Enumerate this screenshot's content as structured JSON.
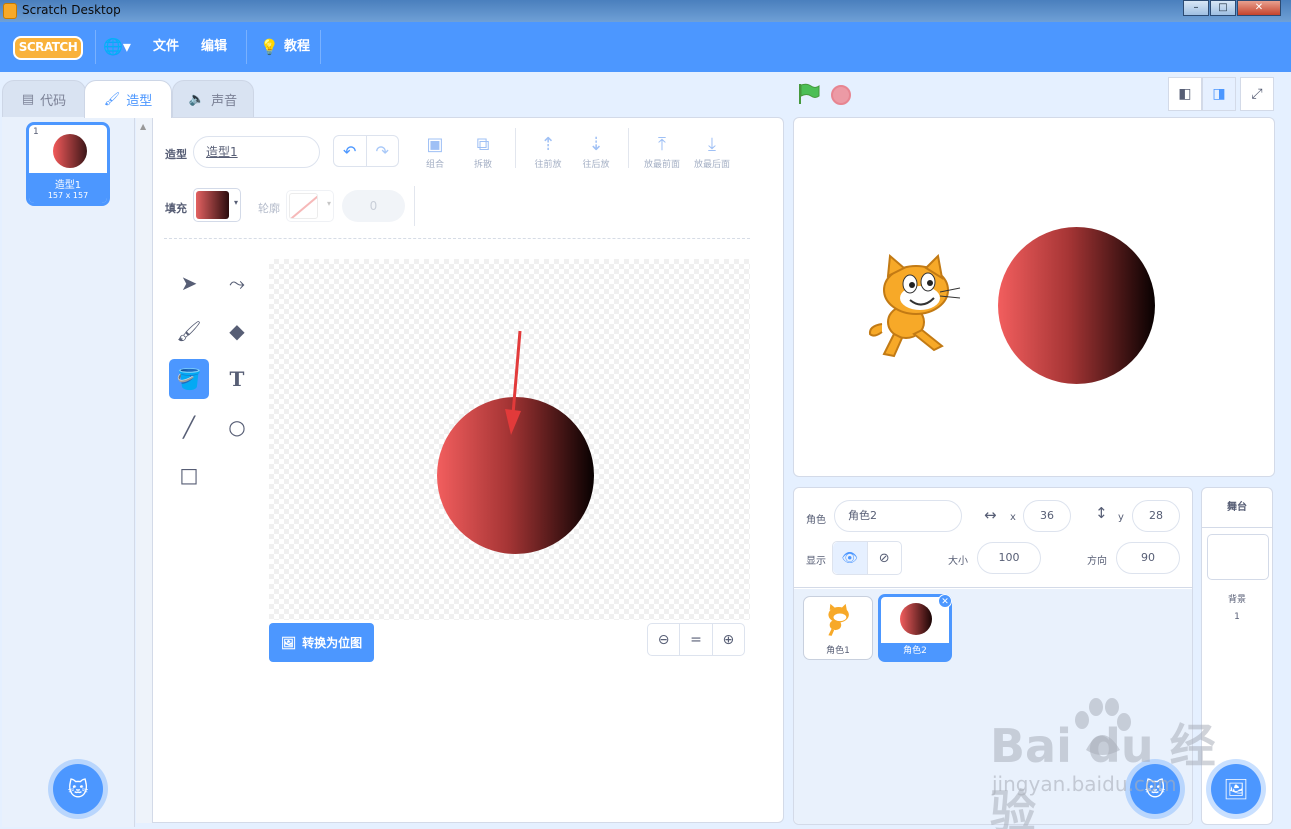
{
  "window": {
    "title": "Scratch Desktop"
  },
  "menu": {
    "logo": "SCRATCH",
    "file": "文件",
    "edit": "编辑",
    "tutorials": "教程"
  },
  "tabs": [
    {
      "label": "代码"
    },
    {
      "label": "造型"
    },
    {
      "label": "声音"
    }
  ],
  "costume_list": [
    {
      "index": "1",
      "name": "造型1",
      "size": "157 x 157"
    }
  ],
  "paint": {
    "costume_label": "造型",
    "costume_name": "造型1",
    "group": "组合",
    "ungroup": "拆散",
    "forward": "往前放",
    "backward": "往后放",
    "front": "放最前面",
    "back": "放最后面",
    "fill_label": "填充",
    "outline_label": "轮廓",
    "outline_width": "0",
    "convert_button": "转换为位图"
  },
  "sprite_info": {
    "sprite_label": "角色",
    "sprite_name": "角色2",
    "x_label": "x",
    "x": "36",
    "y_label": "y",
    "y": "28",
    "show_label": "显示",
    "size_label": "大小",
    "size": "100",
    "direction_label": "方向",
    "direction": "90"
  },
  "sprites": [
    {
      "name": "角色1"
    },
    {
      "name": "角色2"
    }
  ],
  "stage_panel": {
    "title": "舞台",
    "backdrops_label": "背景",
    "backdrops_count": "1"
  },
  "watermark": {
    "logo": "Bai du 经验",
    "url": "jingyan.baidu.com"
  },
  "colors": {
    "accent": "#4c97ff",
    "menu_bar": "#4c97ff",
    "fill_start": "#f25e5e",
    "fill_end": "#080101"
  }
}
